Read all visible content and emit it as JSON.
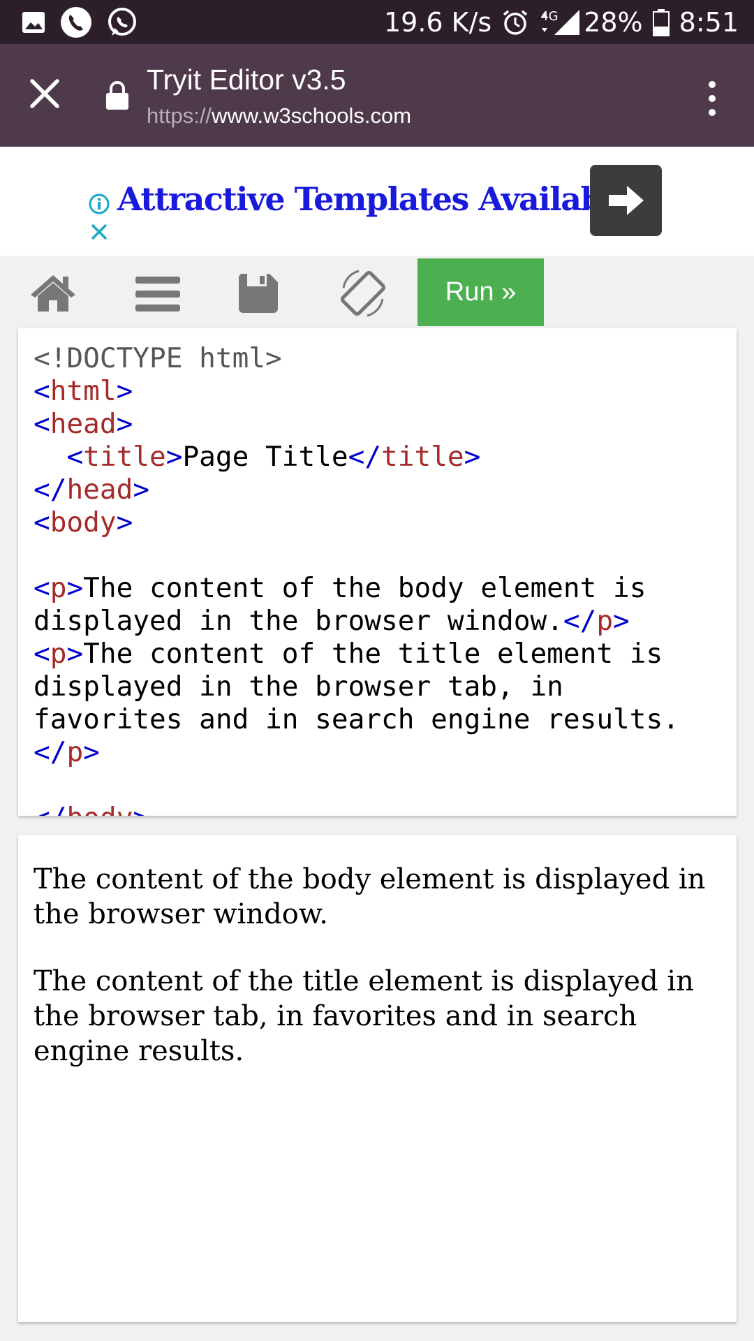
{
  "status_bar": {
    "speed": "19.6 K/s",
    "network": "4G",
    "battery": "28%",
    "time": "8:51",
    "icons": [
      "image-icon",
      "phone-icon",
      "whatsapp-icon",
      "alarm-icon",
      "signal-icon",
      "battery-icon"
    ]
  },
  "app_bar": {
    "title": "Tryit Editor v3.5",
    "url_scheme": "https://",
    "url_host": "www.w3schools.com"
  },
  "ad": {
    "text": "Attractive Templates Available"
  },
  "toolbar": {
    "run_label": "Run »",
    "icons": [
      "home-icon",
      "menu-icon",
      "save-icon",
      "rotate-icon"
    ]
  },
  "editor": {
    "l1": "<!DOCTYPE html>",
    "lt": "<",
    "gt": ">",
    "lts": "</",
    "html": "html",
    "head": "head",
    "title": "title",
    "body": "body",
    "p": "p",
    "indent": "  ",
    "title_text": "Page Title",
    "p1_line1": "The content of the body element is",
    "p1_line2": "displayed in the browser window.",
    "p2_line1": "The content of the title element is",
    "p2_line2": "displayed in the browser tab, in",
    "p2_line3": "favorites and in search engine results."
  },
  "result": {
    "p1": "The content of the body element is displayed in the browser window.",
    "p2": "The content of the title element is displayed in the browser tab, in favorites and in search engine results."
  },
  "colors": {
    "status_bar": "#2c1f2a",
    "app_bar": "#4e3a4a",
    "run_button": "#4caf50",
    "tag_name": "#a52a2a",
    "tag_bracket": "#0000cd",
    "ad_text": "#1a1adc"
  }
}
